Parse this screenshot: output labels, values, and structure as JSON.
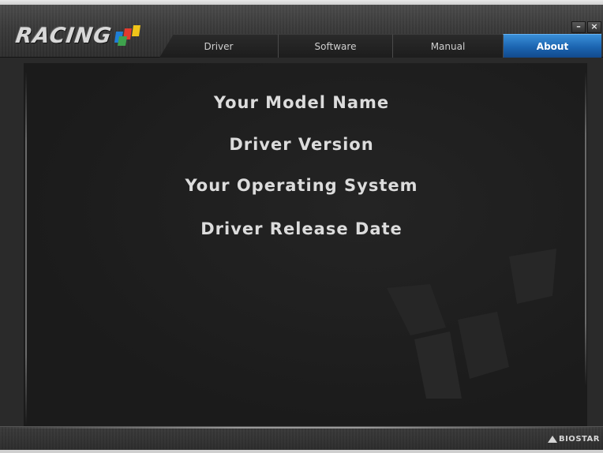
{
  "app": {
    "logo_text": "RACING",
    "brand_text": "BIOSTAR"
  },
  "window_controls": {
    "minimize": "–",
    "close": "×"
  },
  "tabs": [
    {
      "label": "Driver",
      "active": false
    },
    {
      "label": "Software",
      "active": false
    },
    {
      "label": "Manual",
      "active": false
    },
    {
      "label": "About",
      "active": true
    }
  ],
  "about": {
    "model_name": "Your Model Name",
    "driver_version": "Driver Version",
    "operating_system": "Your Operating System",
    "release_date": "Driver Release Date"
  },
  "colors": {
    "accent": "#1b64b0",
    "background": "#1e1e1e",
    "text": "#dcdcdc"
  }
}
